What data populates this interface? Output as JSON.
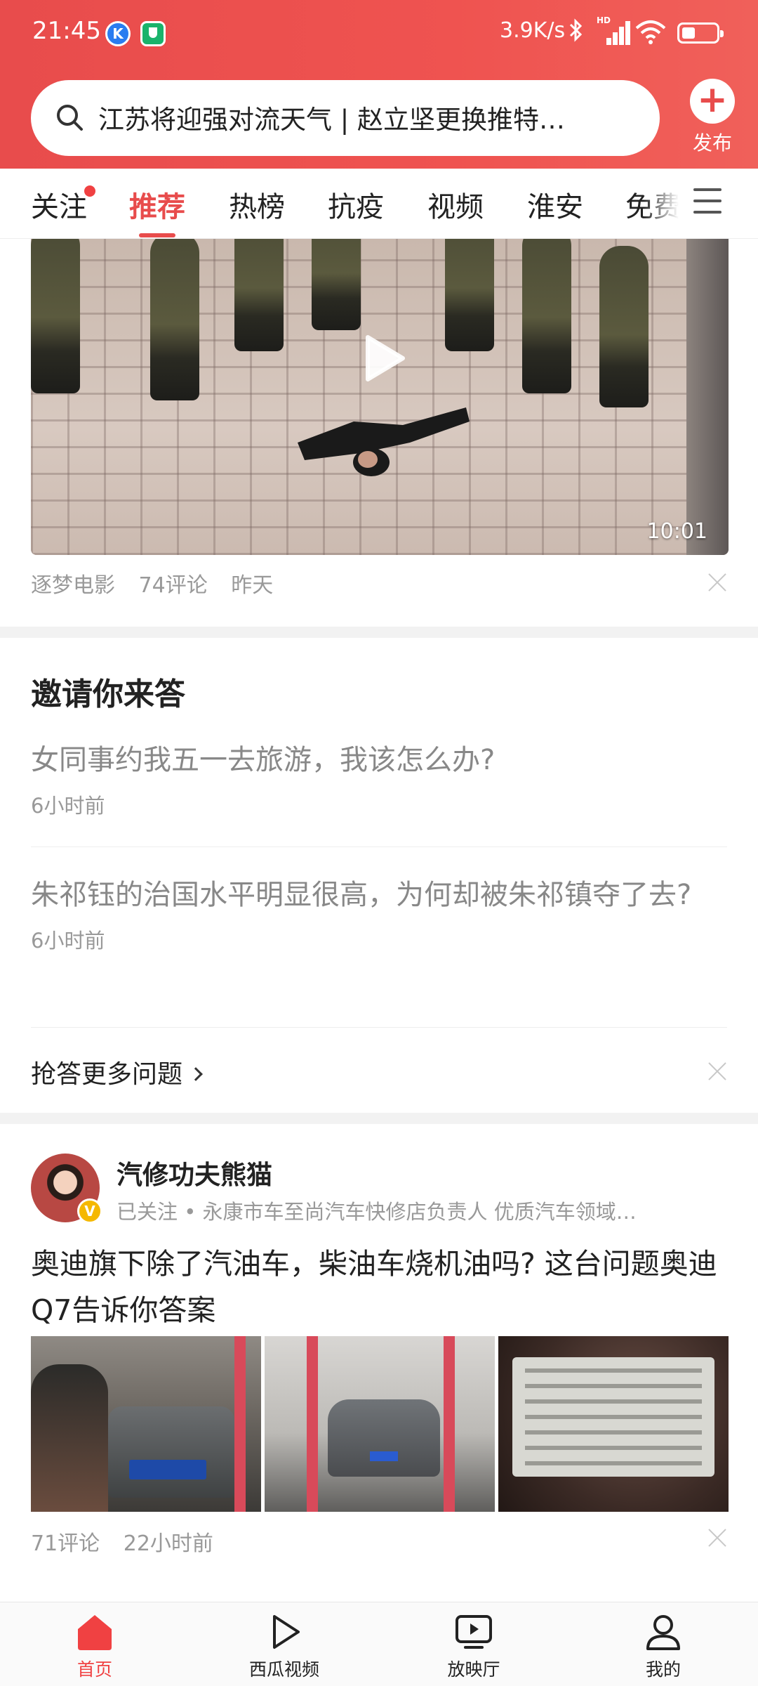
{
  "status_bar": {
    "time": "21:45",
    "app_badge_k": "K",
    "network_speed": "3.9K/s",
    "signal_label": "HD"
  },
  "search": {
    "query": "江苏将迎强对流天气 | 赵立坚更换推特…",
    "icon": "search-icon"
  },
  "publish": {
    "label": "发布",
    "icon": "plus-icon"
  },
  "tabs": [
    {
      "label": "关注",
      "has_dot": true
    },
    {
      "label": "推荐",
      "active": true
    },
    {
      "label": "热榜"
    },
    {
      "label": "抗疫"
    },
    {
      "label": "视频"
    },
    {
      "label": "淮安"
    },
    {
      "label": "免费"
    }
  ],
  "video_card": {
    "duration": "10:01",
    "source": "逐梦电影",
    "comments": "74评论",
    "time": "昨天"
  },
  "invite": {
    "title": "邀请你来答",
    "questions": [
      {
        "text": "女同事约我五一去旅游，我该怎么办?",
        "time": "6小时前"
      },
      {
        "text": "朱祁钰的治国水平明显很高，为何却被朱祁镇夺了去?",
        "time": "6小时前"
      }
    ],
    "more_label": "抢答更多问题"
  },
  "article": {
    "author": "汽修功夫熊猫",
    "verified_badge": "V",
    "author_info": "已关注 • 永康市车至尚汽车快修店负责人 优质汽车领域…",
    "title": "奥迪旗下除了汽油车，柴油车烧机油吗? 这台问题奥迪Q7告诉你答案",
    "comments": "71评论",
    "time": "22小时前"
  },
  "bottom_nav": [
    {
      "label": "首页",
      "icon": "home-icon",
      "active": true
    },
    {
      "label": "西瓜视频",
      "icon": "play-icon"
    },
    {
      "label": "放映厅",
      "icon": "screen-play-icon"
    },
    {
      "label": "我的",
      "icon": "profile-icon"
    }
  ],
  "colors": {
    "brand_red": "#E84C4C",
    "nav_active": "#F04142",
    "secondary_text": "#999999"
  }
}
